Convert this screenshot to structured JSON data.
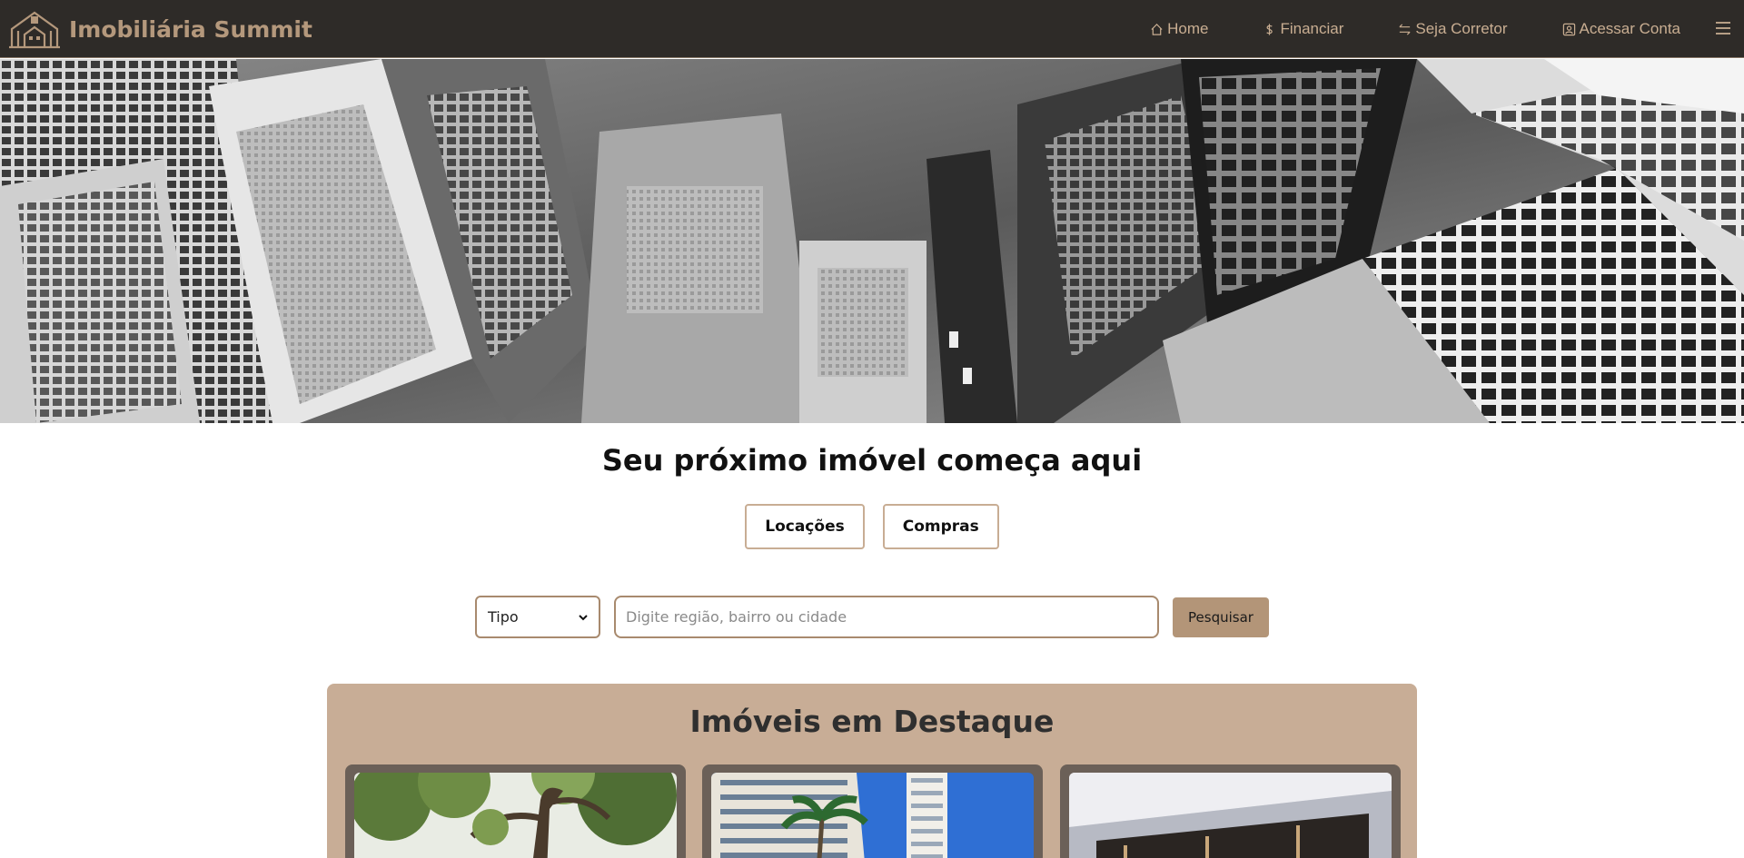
{
  "brand": {
    "name": "Imobiliária Summit",
    "logo_icon": "house-columns-logo-icon"
  },
  "nav": {
    "links": [
      {
        "label": "Home",
        "icon": "home-icon"
      },
      {
        "label": "Financiar",
        "icon": "dollar-icon"
      },
      {
        "label": "Seja Corretor",
        "icon": "arrows-exchange-icon"
      },
      {
        "label": "Acessar Conta",
        "icon": "user-card-icon"
      }
    ],
    "menu_icon": "hamburger-menu-icon"
  },
  "hero": {
    "image": "black-and-white aerial city skyscrapers"
  },
  "headline": "Seu próximo imóvel começa aqui",
  "modes": {
    "rent_label": "Locações",
    "buy_label": "Compras"
  },
  "search": {
    "type_selected": "Tipo",
    "placeholder": "Digite região, bairro ou cidade",
    "button_label": "Pesquisar"
  },
  "featured": {
    "title": "Imóveis em Destaque",
    "cards": [
      {
        "image": "tree canopy with building"
      },
      {
        "image": "tall residential tower with palm trees and blue sky"
      },
      {
        "image": "modern building facade"
      }
    ]
  },
  "colors": {
    "navbar_bg": "#2e2b28",
    "accent": "#b4987c",
    "featured_bg": "#c8ad96",
    "button_bg": "#b39578"
  }
}
